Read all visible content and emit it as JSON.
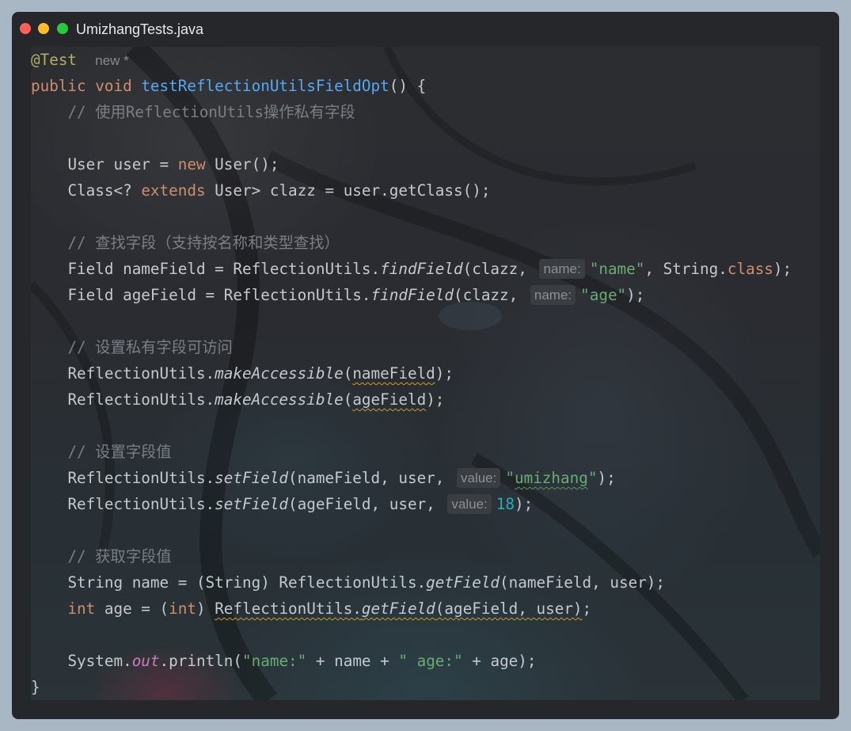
{
  "window": {
    "title": "UmizhangTests.java",
    "colors": {
      "close": "#fe5f57",
      "minimize": "#febc2e",
      "maximize": "#28c840"
    }
  },
  "code": {
    "annotation": "@Test",
    "usage_hint": "new *",
    "kw_public": "public",
    "kw_void": "void",
    "method_name": "testReflectionUtilsFieldOpt",
    "sig_tail": "() {",
    "comment1": "// 使用ReflectionUtils操作私有字段",
    "l4_a": "User user = ",
    "l4_new": "new",
    "l4_b": " User();",
    "l5_a": "Class<? ",
    "l5_extends": "extends",
    "l5_b": " User> clazz = user.getClass();",
    "comment2": "// 查找字段（支持按名称和类型查找）",
    "l7_a": "Field nameField = ReflectionUtils.",
    "l7_fn": "findField",
    "l7_b": "(clazz, ",
    "l7_hint": "name:",
    "l7_str": "\"name\"",
    "l7_c": ", String.",
    "l7_class": "class",
    "l7_d": ");",
    "l8_a": "Field ageField = ReflectionUtils.",
    "l8_fn": "findField",
    "l8_b": "(clazz, ",
    "l8_hint": "name:",
    "l8_str": "\"age\"",
    "l8_c": ");",
    "comment3": "// 设置私有字段可访问",
    "l10_a": "ReflectionUtils.",
    "l10_fn": "makeAccessible",
    "l10_b": "(",
    "l10_arg": "nameField",
    "l10_c": ");",
    "l11_a": "ReflectionUtils.",
    "l11_fn": "makeAccessible",
    "l11_b": "(",
    "l11_arg": "ageField",
    "l11_c": ");",
    "comment4": "// 设置字段值",
    "l13_a": "ReflectionUtils.",
    "l13_fn": "setField",
    "l13_b": "(nameField, user, ",
    "l13_hint": "value:",
    "l13_q1": "\"",
    "l13_str": "umizhang",
    "l13_q2": "\"",
    "l13_c": ");",
    "l14_a": "ReflectionUtils.",
    "l14_fn": "setField",
    "l14_b": "(ageField, user, ",
    "l14_hint": "value:",
    "l14_num": "18",
    "l14_c": ");",
    "comment5": "// 获取字段值",
    "l16_a": "String name = (String) ReflectionUtils.",
    "l16_fn": "getField",
    "l16_b": "(nameField, user);",
    "l17_int1": "int",
    "l17_a": " age = (",
    "l17_int2": "int",
    "l17_b": ") ",
    "l17_c": "ReflectionUtils.",
    "l17_fn": "getField",
    "l17_d": "(ageField, user)",
    "l17_e": ";",
    "l19_a": "System.",
    "l19_out": "out",
    "l19_b": ".println(",
    "l19_s1": "\"name:\"",
    "l19_c": " + name + ",
    "l19_s2": "\" age:\"",
    "l19_d": " + age);",
    "closing": "}"
  }
}
